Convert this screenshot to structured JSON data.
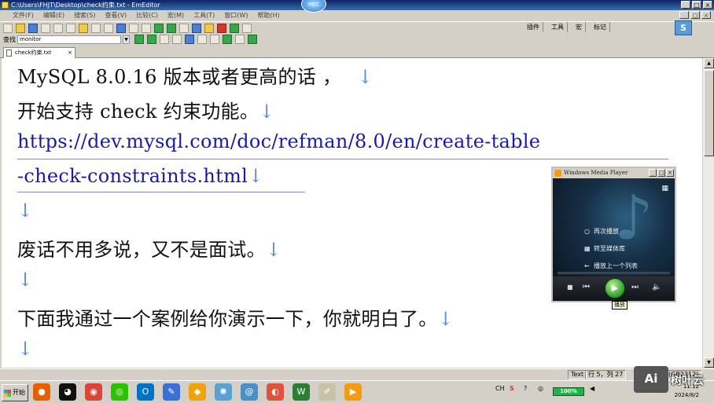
{
  "window": {
    "title": "C:\\Users\\FHJT\\Desktop\\check约束.txt - EmEditor",
    "controls": [
      "_",
      "□",
      "×"
    ]
  },
  "recording_badge": "REC",
  "menubar": {
    "items": [
      "文件(F)",
      "编辑(E)",
      "搜索(S)",
      "查看(V)",
      "比较(C)",
      "宏(M)",
      "工具(T)",
      "窗口(W)",
      "帮助(H)"
    ],
    "controls": [
      "_",
      "□",
      "×"
    ]
  },
  "toolbar_right": {
    "plugins_label": "插件",
    "tools_label": "工具",
    "macro_label": "宏",
    "marker_label": "标记",
    "badge": "S"
  },
  "findbar": {
    "label": "查找",
    "value": "monitor"
  },
  "tab": {
    "label": "check约束.txt",
    "close": "×"
  },
  "editor": {
    "lines": [
      "MySQL 8.0.16 版本或者更高的话 ，",
      "开始支持 check 约束功能。",
      "https://dev.mysql.com/doc/refman/8.0/en/create-table",
      "-check-constraints.html",
      "",
      "废话不用多说，又不是面试。",
      "",
      "下面我通过一个案例给你演示一下，你就明白了。",
      ""
    ],
    "return_mark": "↓"
  },
  "statusbar": {
    "encoding": "Text",
    "position": "行 5，列 27",
    "charset_partial": "(GB2312)"
  },
  "media_player": {
    "title": "Windows Media Player",
    "menu": [
      {
        "icon": "○",
        "label": "再次播放"
      },
      {
        "icon": "▦",
        "label": "转至媒体库"
      },
      {
        "icon": "←",
        "label": "播放上一个列表"
      }
    ],
    "play_tooltip": "播放",
    "grid_icon": "▦"
  },
  "taskbar": {
    "start_label": "开始",
    "apps": [
      {
        "name": "firefox",
        "glyph": "●",
        "color": "#e66000"
      },
      {
        "name": "qq",
        "glyph": "◕",
        "color": "#111111"
      },
      {
        "name": "chrome",
        "glyph": "◉",
        "color": "#db4437"
      },
      {
        "name": "wechat",
        "glyph": "◎",
        "color": "#2dc100"
      },
      {
        "name": "outlook",
        "glyph": "O",
        "color": "#0072c6"
      },
      {
        "name": "pen",
        "glyph": "✎",
        "color": "#3a6fd8"
      },
      {
        "name": "shield",
        "glyph": "◆",
        "color": "#f0a30a"
      },
      {
        "name": "swirl",
        "glyph": "✺",
        "color": "#5aa0d0"
      },
      {
        "name": "at",
        "glyph": "@",
        "color": "#4a90c8"
      },
      {
        "name": "bird",
        "glyph": "◐",
        "color": "#e0523c"
      },
      {
        "name": "word",
        "glyph": "W",
        "color": "#2e7d32"
      },
      {
        "name": "notes",
        "glyph": "✐",
        "color": "#c9c2a6"
      },
      {
        "name": "player",
        "glyph": "▶",
        "color": "#f39c12"
      }
    ],
    "ime": "CH",
    "battery": "100%",
    "time": "11:12",
    "date": "2024/8/2"
  },
  "watermark": {
    "box_text": "Ai",
    "text": "树叶云"
  }
}
